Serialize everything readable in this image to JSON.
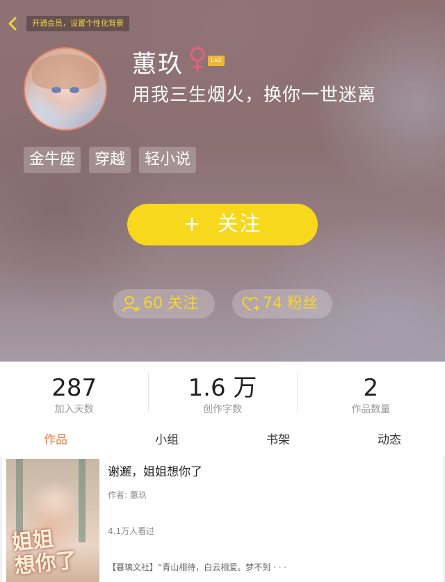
{
  "header": {
    "back_icon": "chevron-left-icon",
    "vip_banner": "开通会员，设置个性化背景",
    "username": "蕙玖",
    "gender_icon": "female-icon",
    "level": "Lv2",
    "signature": "用我三生烟火，换你一世迷离",
    "tags": [
      "金牛座",
      "穿越",
      "轻小说"
    ],
    "follow_button": {
      "icon": "+",
      "label": "关注"
    },
    "following": {
      "icon": "user-add-icon",
      "label": "60 关注"
    },
    "fans": {
      "icon": "heart-add-icon",
      "label": "74 粉丝"
    }
  },
  "stats": [
    {
      "value": "287",
      "label": "加入天数"
    },
    {
      "value": "1.6 万",
      "label": "创作字数"
    },
    {
      "value": "2",
      "label": "作品数量"
    }
  ],
  "tabs": [
    {
      "label": "作品",
      "active": true
    },
    {
      "label": "小组",
      "active": false
    },
    {
      "label": "书架",
      "active": false
    },
    {
      "label": "动态",
      "active": false
    }
  ],
  "works": [
    {
      "title": "谢邂，姐姐想你了",
      "author": "作者: 蕙玖",
      "views": "4.1万人看过",
      "description": "【暮璃文社】“青山相待，白云相爱。梦不到 · · ·",
      "cover_text": [
        "姐姐",
        "想你了"
      ]
    }
  ],
  "colors": {
    "accent_yellow": "#f8d81c",
    "pill_text": "#f6d52b",
    "active_tab": "#f07a3a",
    "gender_pink": "#e8607e",
    "level_badge": "#f2b632"
  }
}
